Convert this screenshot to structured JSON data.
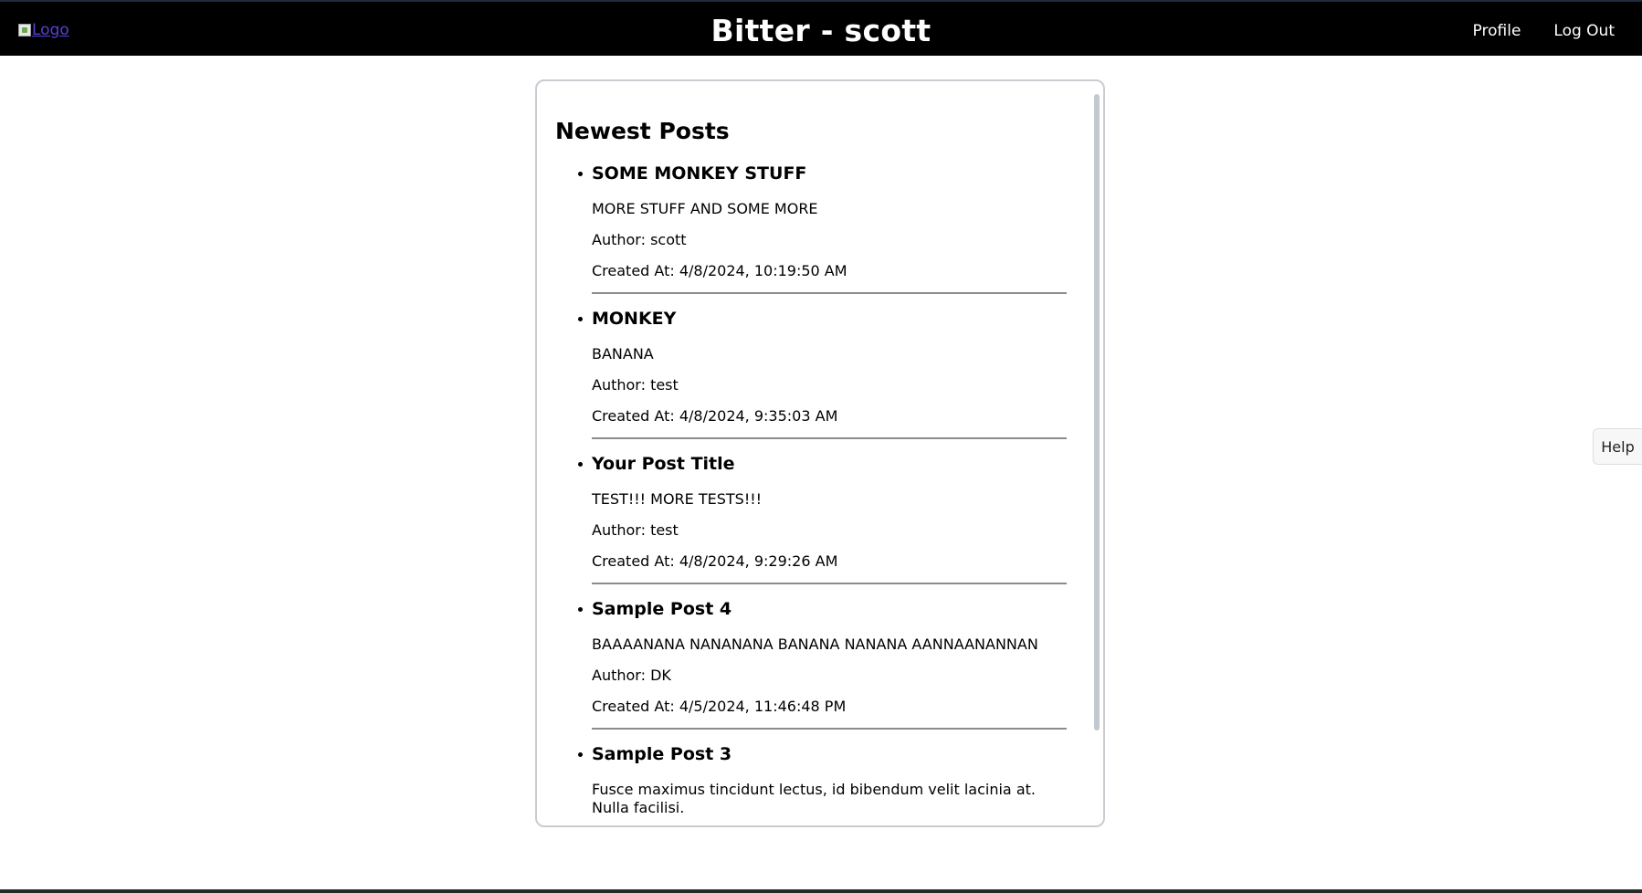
{
  "header": {
    "logo_alt": "Logo",
    "title": "Bitter - scott",
    "nav": [
      {
        "label": "Profile"
      },
      {
        "label": "Log Out"
      }
    ]
  },
  "feed": {
    "heading": "Newest Posts",
    "posts": [
      {
        "title": "SOME MONKEY STUFF",
        "body": "MORE STUFF AND SOME MORE",
        "author": "Author: scott",
        "created": "Created At: 4/8/2024, 10:19:50 AM"
      },
      {
        "title": "MONKEY",
        "body": "BANANA",
        "author": "Author: test",
        "created": "Created At: 4/8/2024, 9:35:03 AM"
      },
      {
        "title": "Your Post Title",
        "body": "TEST!!! MORE TESTS!!!",
        "author": "Author: test",
        "created": "Created At: 4/8/2024, 9:29:26 AM"
      },
      {
        "title": "Sample Post 4",
        "body": "BAAAANANA NANANANA BANANA NANANA AANNAANANNAN",
        "author": "Author: DK",
        "created": "Created At: 4/5/2024, 11:46:48 PM"
      },
      {
        "title": "Sample Post 3",
        "body": "Fusce maximus tincidunt lectus, id bibendum velit lacinia at. Nulla facilisi.",
        "author": "",
        "created": ""
      }
    ]
  },
  "help": {
    "label": "Help"
  },
  "colors": {
    "header_bg": "#000000",
    "header_text": "#ffffff",
    "link": "#5b3fd6",
    "card_border": "#c9ccd1",
    "divider": "#8c8c8c"
  }
}
